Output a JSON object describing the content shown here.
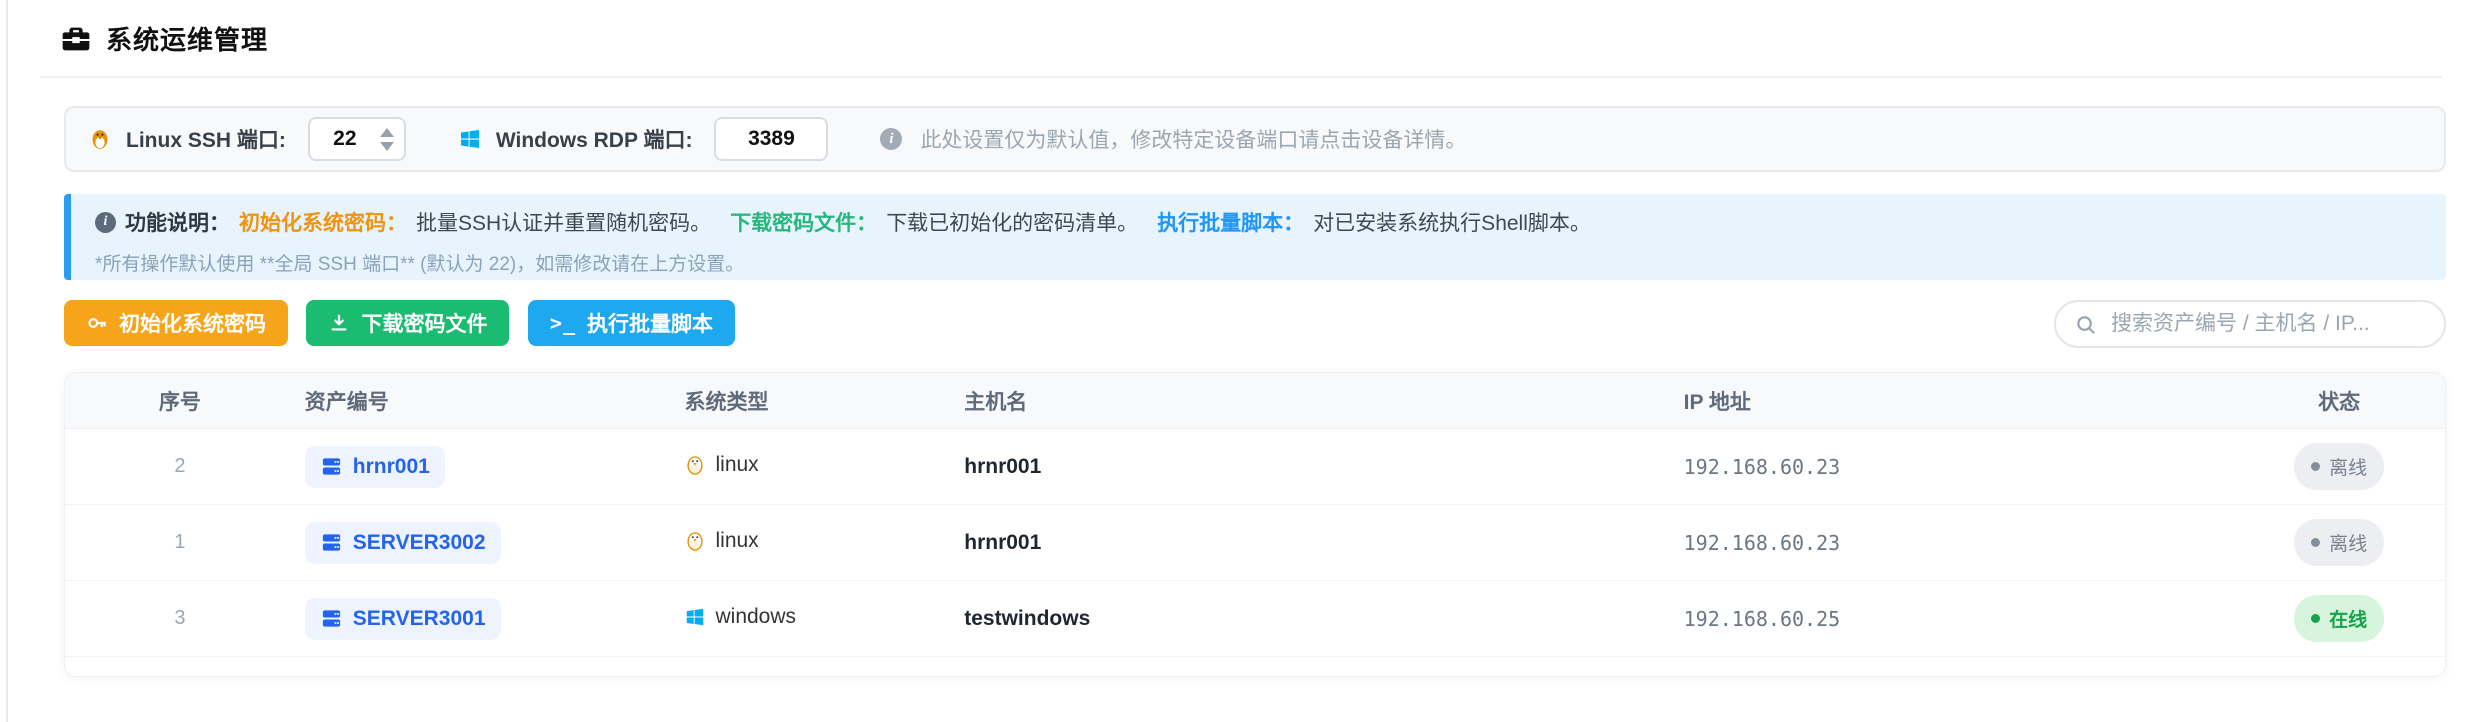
{
  "page": {
    "title": "系统运维管理"
  },
  "settings": {
    "ssh_label": "Linux SSH 端口:",
    "ssh_value": "22",
    "rdp_label": "Windows RDP 端口:",
    "rdp_value": "3389",
    "note": "此处设置仅为默认值，修改特定设备端口请点击设备详情。"
  },
  "banner": {
    "intro_label": "功能说明：",
    "segments": [
      {
        "label": "初始化系统密码：",
        "desc": "批量SSH认证并重置随机密码。",
        "color": "#ee9410"
      },
      {
        "label": "下载密码文件：",
        "desc": "下载已初始化的密码清单。",
        "color": "#27b77c"
      },
      {
        "label": "执行批量脚本：",
        "desc": "对已安装系统执行Shell脚本。",
        "color": "#2196f3"
      }
    ],
    "footnote": "*所有操作默认使用 **全局 SSH 端口** (默认为 22)，如需修改请在上方设置。"
  },
  "toolbar": {
    "init_button": "初始化系统密码",
    "download_button": "下载密码文件",
    "script_button": "执行批量脚本",
    "search_placeholder": "搜索资产编号 / 主机名 / IP..."
  },
  "table": {
    "headers": [
      "序号",
      "资产编号",
      "系统类型",
      "主机名",
      "IP 地址",
      "状态"
    ],
    "rows": [
      {
        "index": "2",
        "asset": "hrnr001",
        "os": "linux",
        "hostname": "hrnr001",
        "ip": "192.168.60.23",
        "status": "离线",
        "online": false
      },
      {
        "index": "1",
        "asset": "SERVER3002",
        "os": "linux",
        "hostname": "hrnr001",
        "ip": "192.168.60.23",
        "status": "离线",
        "online": false
      },
      {
        "index": "3",
        "asset": "SERVER3001",
        "os": "windows",
        "hostname": "testwindows",
        "ip": "192.168.60.25",
        "status": "在线",
        "online": true
      }
    ]
  },
  "colors": {
    "accent_blue": "#2196f3",
    "link_blue": "#2463eb",
    "button_orange": "#f6a51b",
    "button_green": "#1cbb72",
    "button_blue": "#1ea8ef",
    "banner_bg": "#e8f4fd",
    "online_green": "#17a24b",
    "offline_gray": "#79828f"
  }
}
